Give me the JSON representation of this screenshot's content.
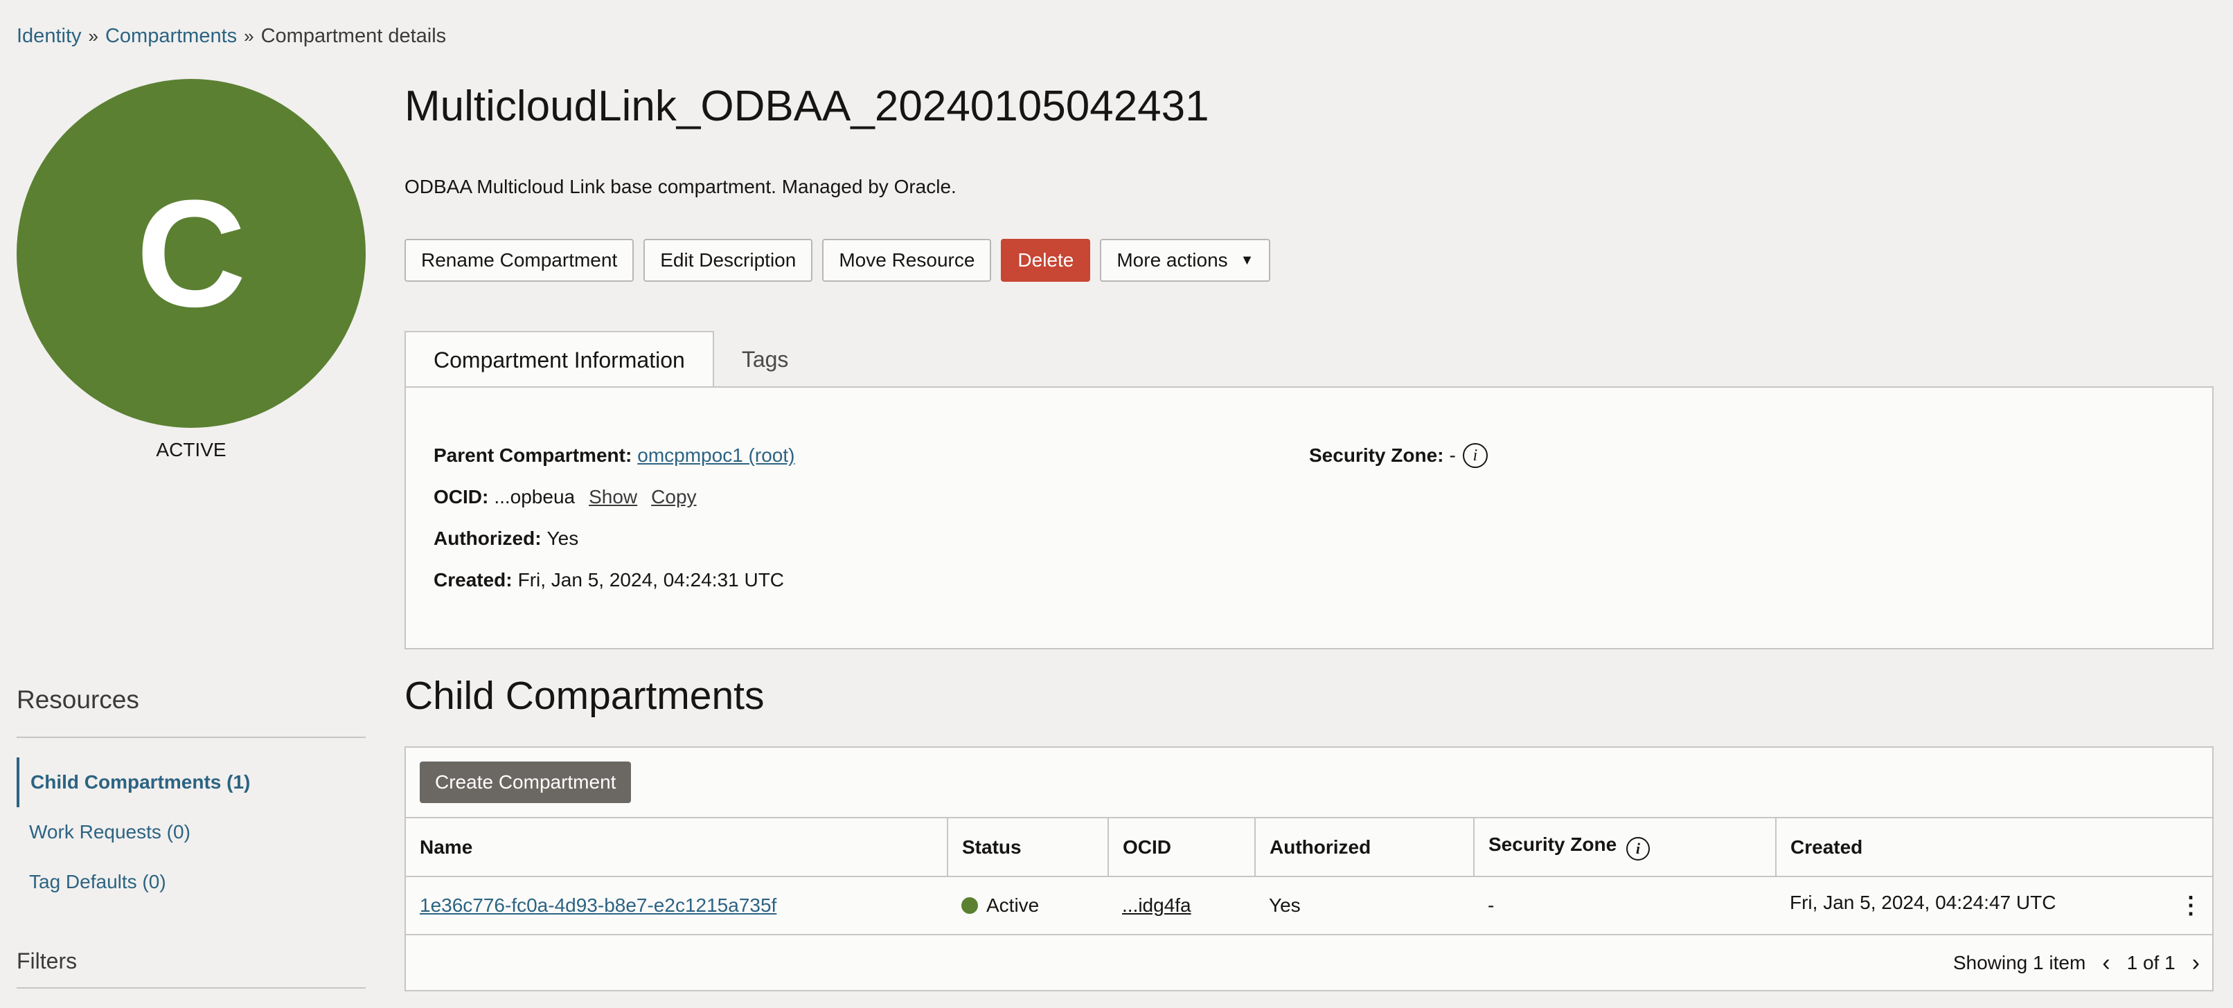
{
  "breadcrumb": {
    "identity": "Identity",
    "compartments": "Compartments",
    "current": "Compartment details",
    "separator": "»"
  },
  "avatar": {
    "letter": "C",
    "status": "ACTIVE",
    "color": "#5b8032"
  },
  "header": {
    "title": "MulticloudLink_ODBAA_20240105042431",
    "description": "ODBAA Multicloud Link base compartment. Managed by Oracle."
  },
  "actions": {
    "rename": "Rename Compartment",
    "edit": "Edit Description",
    "move": "Move Resource",
    "delete": "Delete",
    "more": "More actions"
  },
  "tabs": {
    "info": "Compartment Information",
    "tags": "Tags"
  },
  "info": {
    "parent_label": "Parent Compartment:",
    "parent_value": "omcpmpoc1 (root)",
    "ocid_label": "OCID:",
    "ocid_value": "...opbeua",
    "ocid_show": "Show",
    "ocid_copy": "Copy",
    "authorized_label": "Authorized:",
    "authorized_value": "Yes",
    "created_label": "Created:",
    "created_value": "Fri, Jan 5, 2024, 04:24:31 UTC",
    "security_label": "Security Zone:",
    "security_value": "-"
  },
  "resources": {
    "title": "Resources",
    "items": [
      {
        "label": "Child Compartments (1)"
      },
      {
        "label": "Work Requests (0)"
      },
      {
        "label": "Tag Defaults (0)"
      }
    ],
    "filters_title": "Filters"
  },
  "child": {
    "title": "Child Compartments",
    "create_button": "Create Compartment",
    "columns": {
      "name": "Name",
      "status": "Status",
      "ocid": "OCID",
      "authorized": "Authorized",
      "security_zone": "Security Zone",
      "created": "Created"
    },
    "rows": [
      {
        "name": "1e36c776-fc0a-4d93-b8e7-e2c1215a735f",
        "status": "Active",
        "ocid": "...idg4fa",
        "authorized": "Yes",
        "security_zone": "-",
        "created": "Fri, Jan 5, 2024, 04:24:47 UTC"
      }
    ],
    "showing": "Showing 1 item",
    "page": "1 of 1"
  }
}
